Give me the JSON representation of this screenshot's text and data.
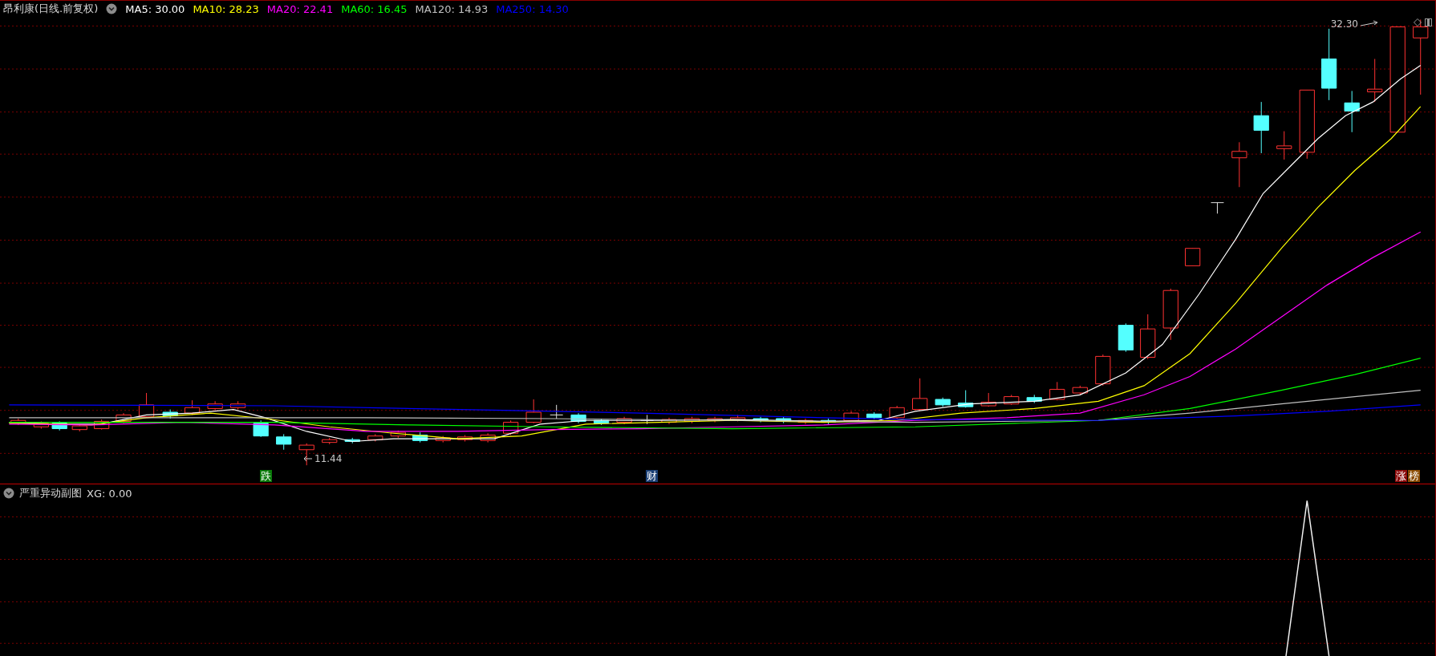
{
  "header": {
    "title": "昂利康(日线.前复权)",
    "indicators": [
      {
        "text": "MA5: 30.00",
        "color": "#ffffff"
      },
      {
        "text": "MA10: 28.23",
        "color": "#ffff00"
      },
      {
        "text": "MA20: 22.41",
        "color": "#ff00ff"
      },
      {
        "text": "MA60: 16.45",
        "color": "#00ff00"
      },
      {
        "text": "MA120: 14.93",
        "color": "#c0c0c0"
      },
      {
        "text": "MA250: 14.30",
        "color": "#0000ff"
      }
    ]
  },
  "main_chart": {
    "high_label": "32.30",
    "low_label": "11.44",
    "markers": [
      {
        "text": "跌",
        "color": "#0a7a0a"
      },
      {
        "text": "财",
        "color": "#1a3f75"
      },
      {
        "text": "涨",
        "color": "#8c0a0a"
      },
      {
        "text": "榜",
        "color": "#8a4a00"
      }
    ]
  },
  "sub_chart": {
    "title": "严重异动副图",
    "indicator": "XG: 0.00"
  }
}
